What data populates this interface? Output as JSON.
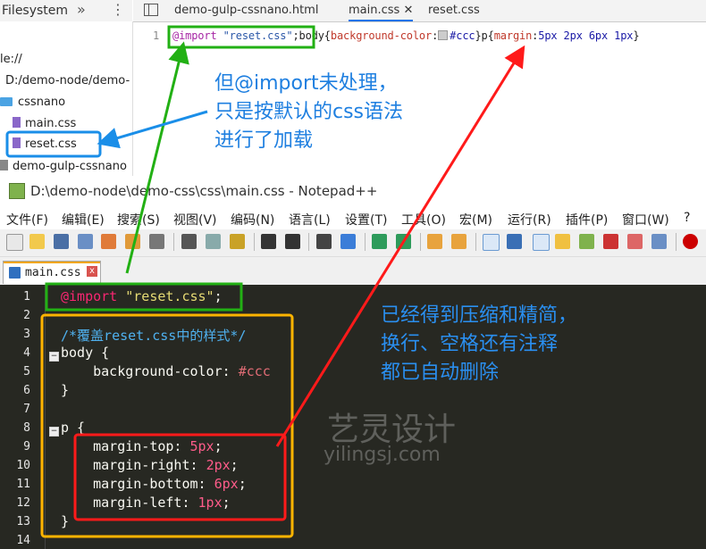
{
  "devtools": {
    "filesystem_label": "Filesystem",
    "tree": {
      "root_label": "le://",
      "path_label": "D:/demo-node/demo-",
      "folder_cssnano": "cssnano",
      "file_main": "main.css",
      "file_reset": "reset.css",
      "folder_demo": "demo-gulp-cssnano"
    },
    "tabs": [
      "demo-gulp-cssnano.html",
      "main.css",
      "reset.css"
    ],
    "editor": {
      "line_number": "1",
      "import_kw": "@import",
      "import_str": "\"reset.css\"",
      "after_import": ";body{",
      "prop1": "background-color",
      "colon1": ":",
      "color_val": "#ccc",
      "mid": "}p{",
      "prop2": "margin",
      "colon2": ":",
      "margin_val": "5px 2px 6px 1px",
      "end": "}"
    }
  },
  "npp": {
    "title": "D:\\demo-node\\demo-css\\css\\main.css - Notepad++",
    "menu": [
      "文件(F)",
      "编辑(E)",
      "搜索(S)",
      "视图(V)",
      "编码(N)",
      "语言(L)",
      "设置(T)",
      "工具(O)",
      "宏(M)",
      "运行(R)",
      "插件(P)",
      "窗口(W)",
      "?"
    ],
    "tab_label": "main.css",
    "tab_close": "x",
    "line_numbers": [
      "1",
      "2",
      "3",
      "4",
      "5",
      "6",
      "7",
      "8",
      "9",
      "10",
      "11",
      "12",
      "13",
      "14"
    ],
    "fold_marker": "−",
    "lines": {
      "l1_at": "@import",
      "l1_str": "\"reset.css\"",
      "l1_end": ";",
      "l3": "/*覆盖reset.css中的样式*/",
      "l4_sel": "body {",
      "l5_prop": "background-color: ",
      "l5_val": "#ccc",
      "l6": "}",
      "l8_sel": "p {",
      "l9_prop": "margin-top: ",
      "l9_val": "5px",
      "l10_prop": "margin-right: ",
      "l10_val": "2px",
      "l11_prop": "margin-bottom: ",
      "l11_val": "6px",
      "l12_prop": "margin-left: ",
      "l12_val": "1px",
      "semi": ";",
      "l13": "}"
    }
  },
  "annotations": {
    "blue_1": "但@import未处理，",
    "blue_2": "只是按默认的css语法",
    "blue_3": "进行了加载",
    "right_1": "已经得到压缩和精简，",
    "right_2": "换行、空格还有注释",
    "right_3": "都已自动删除",
    "watermark_1": "艺灵设计",
    "watermark_2": "yilingsj.com"
  },
  "colors": {
    "green_box": "#22b014",
    "blue_box": "#1a8ee8",
    "orange_box": "#ffb400",
    "red_box": "#ff1a1a",
    "annotation_blue": "#1e7fe0"
  }
}
